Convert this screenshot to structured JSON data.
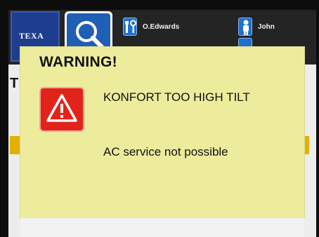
{
  "header": {
    "brand_logo": "TEXA",
    "technician_name": "O.Edwards",
    "customer_name": "John"
  },
  "page": {
    "title": "T"
  },
  "dialog": {
    "title": "WARNING!",
    "message": "KONFORT TOO HIGH TILT",
    "detail": "AC service not possible",
    "icon": "warning-triangle-icon"
  },
  "colors": {
    "dialog_background": "#ecec9c",
    "warning_red": "#e2231a",
    "brand_blue": "#1f3d8f",
    "accent_blue": "#1f5fb5",
    "highlight_yellow": "#e2b100"
  }
}
